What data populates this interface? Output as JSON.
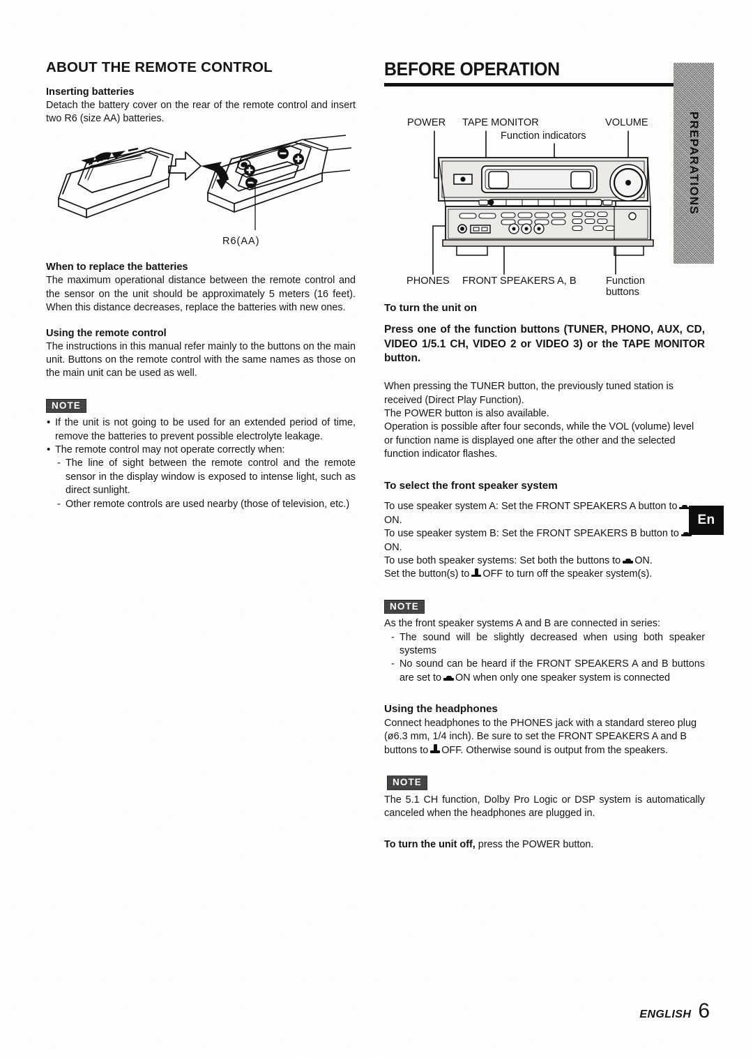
{
  "page": {
    "footer_label": "ENGLISH",
    "page_number": "6",
    "language_badge": "En",
    "side_tab": "PREPARATIONS"
  },
  "left_column": {
    "title": "ABOUT THE REMOTE CONTROL",
    "inserting": {
      "heading": "Inserting batteries",
      "body": "Detach the battery cover on the rear of the remote control and insert two R6 (size AA) batteries."
    },
    "figure": {
      "battery_label": "R6(AA)"
    },
    "replace": {
      "heading": "When to replace the batteries",
      "body": "The maximum operational distance between the remote control and the sensor on the unit should be approximately 5 meters (16 feet). When this distance decreases, replace the batteries with new ones."
    },
    "using": {
      "heading": "Using the remote control",
      "body": "The instructions in this manual refer mainly to the buttons on the main unit. Buttons on the remote control with the same names as those on the main unit can be used as well."
    },
    "note": {
      "badge": "NOTE",
      "bullets": [
        "If the unit is not going to be used for an extended period of time, remove the batteries to prevent possible electrolyte leakage.",
        "The remote control may not operate correctly when:"
      ],
      "sub_bullets": [
        "The line of sight between the remote control and the remote sensor in the display window is exposed to intense light, such as direct sunlight.",
        "Other remote controls are used nearby (those of television, etc.)"
      ]
    }
  },
  "right_column": {
    "title": "BEFORE OPERATION",
    "diagram": {
      "labels": {
        "power": "POWER",
        "tape_monitor": "TAPE MONITOR",
        "function_indicators": "Function indicators",
        "volume": "VOLUME",
        "phones": "PHONES",
        "front_speakers": "FRONT SPEAKERS A, B",
        "function_buttons_l1": "Function",
        "function_buttons_l2": "buttons"
      }
    },
    "turn_on": {
      "heading": "To turn the unit on",
      "bold_instruction": "Press one of the function buttons (TUNER, PHONO, AUX, CD, VIDEO 1/5.1 CH, VIDEO 2 or VIDEO 3) or the TAPE MONITOR button.",
      "lines": [
        "When pressing the TUNER button, the previously tuned station is received (Direct Play Function).",
        "The POWER button is also available.",
        "Operation is possible after four seconds, while the VOL (volume) level or function name is displayed one after the other and the selected function indicator flashes."
      ]
    },
    "speaker_system": {
      "heading": "To select the front speaker system",
      "line_a_pre": "To use speaker system A: Set the FRONT SPEAKERS A button to",
      "line_a_post": "ON.",
      "line_b_pre": "To use speaker system B: Set the FRONT SPEAKERS B button to",
      "line_b_post": "ON.",
      "line_both_pre": "To use both speaker systems: Set both the buttons to",
      "line_both_post": "ON.",
      "line_off_pre": "Set the button(s) to",
      "line_off_post": "OFF to turn off the speaker system(s)."
    },
    "note_speakers": {
      "badge": "NOTE",
      "intro": "As the front speaker systems A and B are connected in series:",
      "items": [
        "The sound will be slightly decreased when using  both speaker systems"
      ],
      "item2_pre": "No sound can be heard if the FRONT SPEAKERS A and B buttons are set to",
      "item2_post": "ON when only one speaker system is connected"
    },
    "headphones": {
      "heading": "Using the headphones",
      "text_pre": "Connect headphones to the PHONES jack with a standard stereo plug (ø6.3 mm, 1/4 inch).  Be sure to set the FRONT SPEAKERS A and B buttons to",
      "text_post": "OFF.  Otherwise sound is output from the speakers."
    },
    "note_headphones": {
      "badge": "NOTE",
      "body": "The 5.1 CH function, Dolby Pro Logic or DSP system is automatically canceled when the headphones are plugged in."
    },
    "turn_off": {
      "bold": "To turn the unit off,",
      "rest": " press the POWER button."
    }
  }
}
